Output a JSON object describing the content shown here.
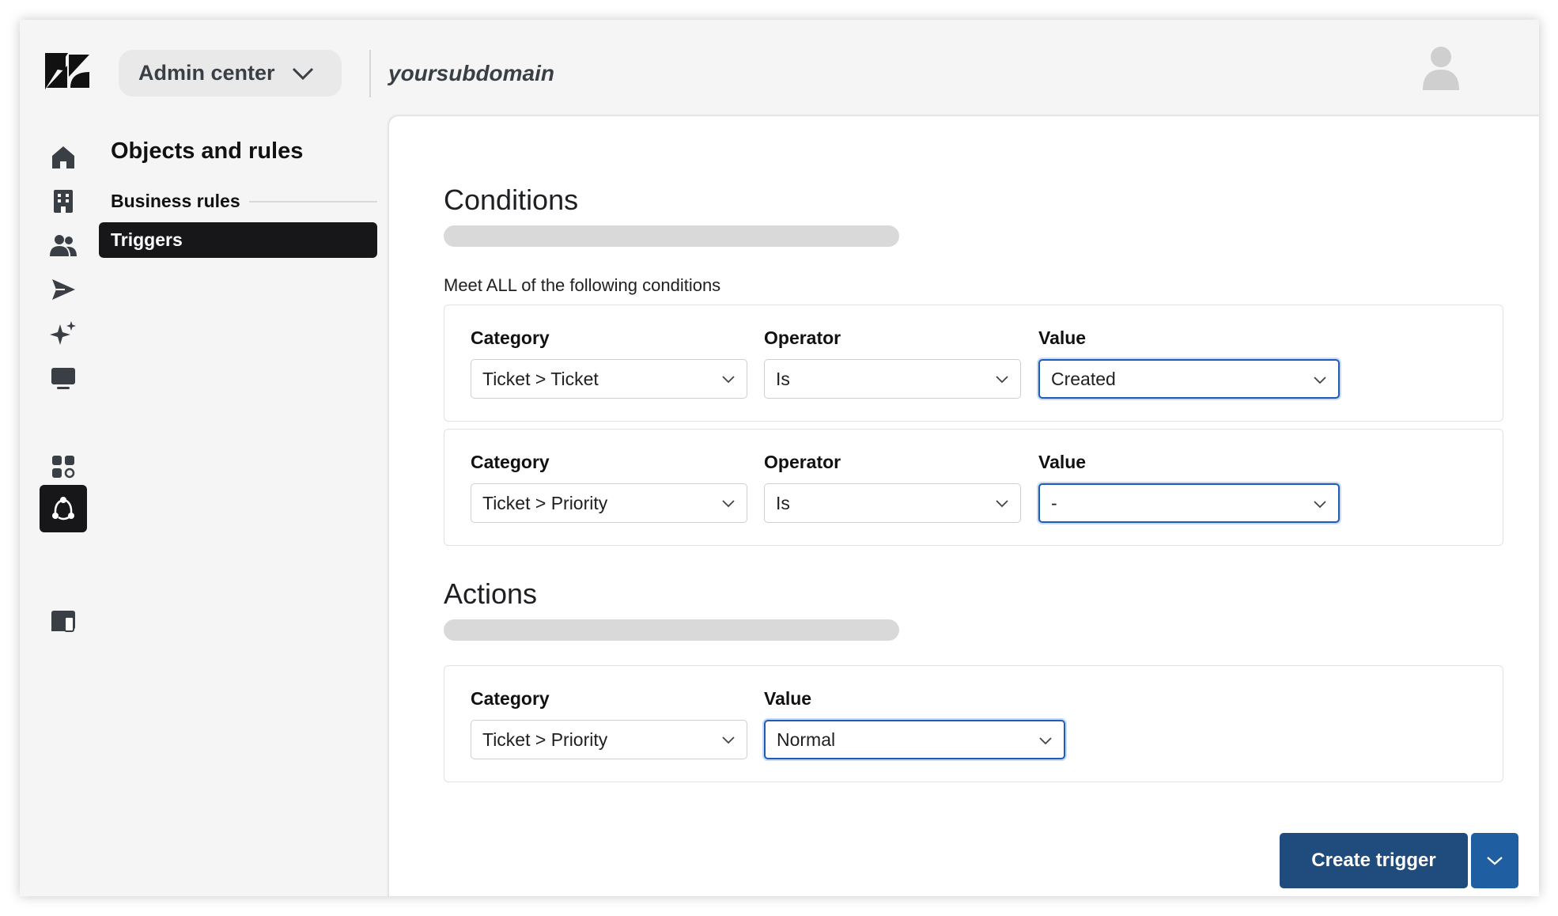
{
  "header": {
    "product_switcher_label": "Admin center",
    "subdomain": "yoursubdomain"
  },
  "rail": {
    "icons": [
      "home-icon",
      "building-icon",
      "people-icon",
      "send-icon",
      "sparkle-icon",
      "workspace-icon",
      "objects-rules-icon",
      "apps-icon",
      "account-icon"
    ],
    "active": "objects-rules-icon"
  },
  "nav": {
    "title": "Objects and rules",
    "section": "Business rules",
    "active_item": "Triggers"
  },
  "conditions": {
    "title": "Conditions",
    "meet_all_label": "Meet ALL of the following conditions",
    "rows": [
      {
        "category_label": "Category",
        "category_value": "Ticket > Ticket",
        "operator_label": "Operator",
        "operator_value": "Is",
        "value_label": "Value",
        "value_value": "Created"
      },
      {
        "category_label": "Category",
        "category_value": "Ticket > Priority",
        "operator_label": "Operator",
        "operator_value": "Is",
        "value_label": "Value",
        "value_value": "-"
      }
    ]
  },
  "actions": {
    "title": "Actions",
    "rows": [
      {
        "category_label": "Category",
        "category_value": "Ticket > Priority",
        "value_label": "Value",
        "value_value": "Normal"
      }
    ]
  },
  "footer": {
    "create_label": "Create trigger"
  },
  "colors": {
    "primary_button": "#1f4b7d",
    "focus_ring": "#1f5cb8",
    "nav_active": "#17171a"
  }
}
